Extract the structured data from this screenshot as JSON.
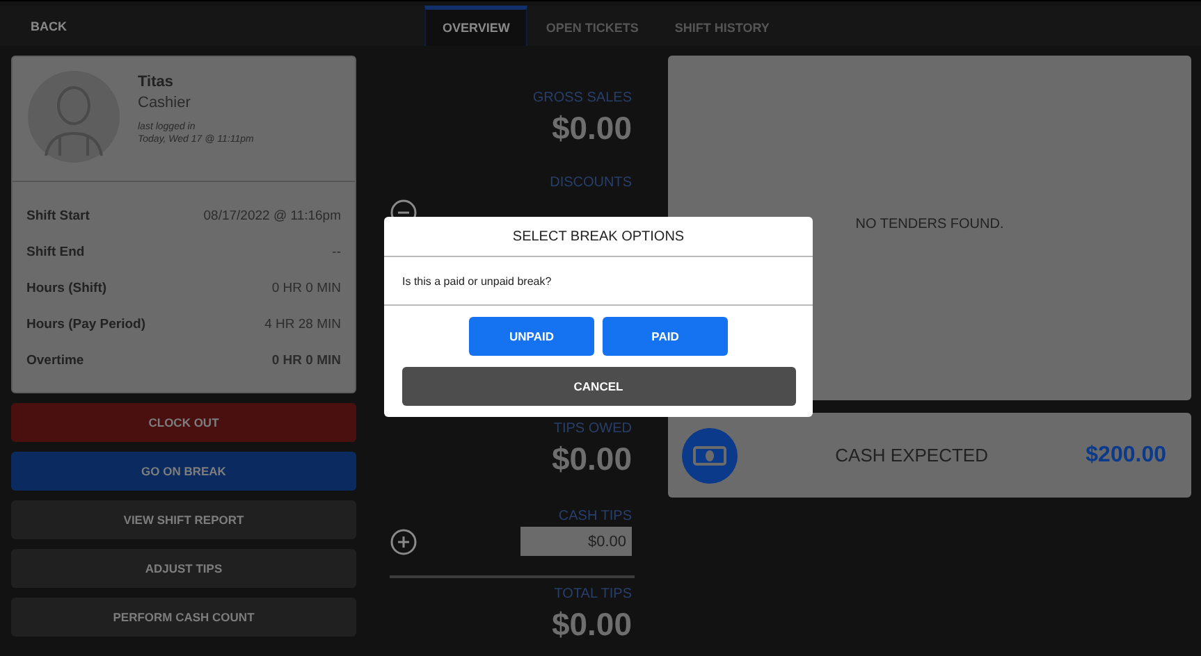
{
  "header": {
    "back": "BACK",
    "tabs": [
      {
        "label": "OVERVIEW",
        "selected": true
      },
      {
        "label": "OPEN TICKETS",
        "selected": false
      },
      {
        "label": "SHIFT HISTORY",
        "selected": false
      }
    ]
  },
  "profile": {
    "name": "Titas",
    "role": "Cashier",
    "last_login_label": "last logged in",
    "last_login_time": "Today, Wed 17 @ 11:11pm"
  },
  "shift_details": [
    {
      "label": "Shift Start",
      "value": "08/17/2022 @ 11:16pm",
      "emphasized": false
    },
    {
      "label": "Shift End",
      "value": "--",
      "emphasized": false
    },
    {
      "label": "Hours (Shift)",
      "value": "0 HR 0 MIN",
      "emphasized": false
    },
    {
      "label": "Hours (Pay Period)",
      "value": "4 HR 28 MIN",
      "emphasized": false
    },
    {
      "label": "Overtime",
      "value": "0 HR 0 MIN",
      "emphasized": true
    }
  ],
  "actions": [
    {
      "label": "CLOCK OUT",
      "kind": "danger"
    },
    {
      "label": "GO ON BREAK",
      "kind": "primary"
    },
    {
      "label": "VIEW SHIFT REPORT",
      "kind": "default"
    },
    {
      "label": "ADJUST TIPS",
      "kind": "default"
    },
    {
      "label": "PERFORM CASH COUNT",
      "kind": "default"
    }
  ],
  "summary": [
    {
      "kind": "amount",
      "label": "GROSS SALES",
      "value": "$0.00"
    },
    {
      "kind": "removable",
      "label": "DISCOUNTS"
    },
    {
      "kind": "amount",
      "label": "TIPS OWED",
      "value": "$0.00"
    },
    {
      "kind": "input",
      "label": "CASH TIPS",
      "value": "$0.00"
    },
    {
      "kind": "total",
      "label": "TOTAL TIPS",
      "value": "$0.00"
    }
  ],
  "tenders": {
    "empty_message": "NO TENDERS FOUND."
  },
  "cash_expected": {
    "label": "CASH EXPECTED",
    "amount": "$200.00"
  },
  "dialog": {
    "title": "SELECT BREAK OPTIONS",
    "message": "Is this a paid or unpaid break?",
    "choices": [
      {
        "label": "UNPAID",
        "kind": "primary"
      },
      {
        "label": "PAID",
        "kind": "primary"
      },
      {
        "label": "CANCEL",
        "kind": "secondary"
      }
    ]
  }
}
